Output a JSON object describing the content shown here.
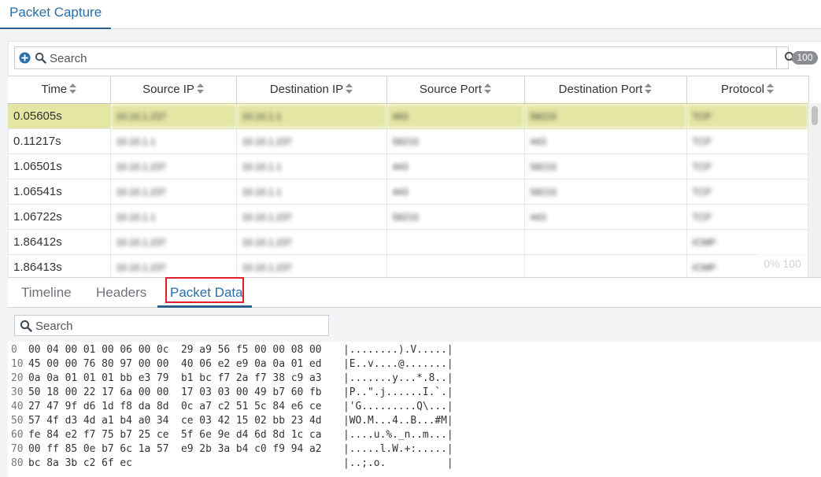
{
  "top_tab": {
    "label": "Packet Capture"
  },
  "search": {
    "placeholder": "Search",
    "count": "100"
  },
  "table": {
    "columns": [
      "Time",
      "Source IP",
      "Destination IP",
      "Source Port",
      "Destination Port",
      "Protocol"
    ],
    "rows": [
      [
        "0.05605s",
        "10.10.1.237",
        "10.10.1.1",
        "443",
        "58215",
        "TCP"
      ],
      [
        "0.11217s",
        "10.10.1.1",
        "10.10.1.237",
        "58215",
        "443",
        "TCP"
      ],
      [
        "1.06501s",
        "10.10.1.237",
        "10.10.1.1",
        "443",
        "58215",
        "TCP"
      ],
      [
        "1.06541s",
        "10.10.1.237",
        "10.10.1.1",
        "443",
        "58215",
        "TCP"
      ],
      [
        "1.06722s",
        "10.10.1.1",
        "10.10.1.237",
        "58215",
        "443",
        "TCP"
      ],
      [
        "1.86412s",
        "10.10.1.237",
        "10.10.1.237",
        "",
        "",
        "ICMP"
      ],
      [
        "1.86413s",
        "10.10.1.237",
        "10.10.1.237",
        "",
        "",
        "ICMP"
      ]
    ],
    "selected_row": 0,
    "zoom_overlay": "0% 100"
  },
  "detail_tabs": {
    "timeline": "Timeline",
    "headers": "Headers",
    "packet_data": "Packet Data",
    "active": "Packet Data"
  },
  "hex": {
    "search_placeholder": "Search",
    "lines": [
      {
        "offset": "0",
        "bytes": "00 04 00 01 00 06 00 0c  29 a9 56 f5 00 00 08 00",
        "ascii": "|........).V.....|"
      },
      {
        "offset": "10",
        "bytes": "45 00 00 76 80 97 00 00  40 06 e2 e9 0a 0a 01 ed",
        "ascii": "|E..v....@.......|"
      },
      {
        "offset": "20",
        "bytes": "0a 0a 01 01 01 bb e3 79  b1 bc f7 2a f7 38 c9 a3",
        "ascii": "|.......y...*.8..|"
      },
      {
        "offset": "30",
        "bytes": "50 18 00 22 17 6a 00 00  17 03 03 00 49 b7 60 fb",
        "ascii": "|P..\".j......I.`.|"
      },
      {
        "offset": "40",
        "bytes": "27 47 9f d6 1d f8 da 8d  0c a7 c2 51 5c 84 e6 ce",
        "ascii": "|'G.........Q\\...|"
      },
      {
        "offset": "50",
        "bytes": "57 4f d3 4d a1 b4 a0 34  ce 03 42 15 02 bb 23 4d",
        "ascii": "|WO.M...4..B...#M|"
      },
      {
        "offset": "60",
        "bytes": "fe 84 e2 f7 75 b7 25 ce  5f 6e 9e d4 6d 8d 1c ca",
        "ascii": "|....u.%._n..m...|"
      },
      {
        "offset": "70",
        "bytes": "00 ff 85 0e b7 6c 1a 57  e9 2b 3a b4 c0 f9 94 a2",
        "ascii": "|.....l.W.+:.....|"
      },
      {
        "offset": "80",
        "bytes": "bc 8a 3b c2 6f ec",
        "ascii": "|..;.o.          |"
      }
    ]
  },
  "colors": {
    "accent": "#2a6ea9",
    "selected_row": "#e4e6a4",
    "highlight_box": "#e01f2b"
  }
}
